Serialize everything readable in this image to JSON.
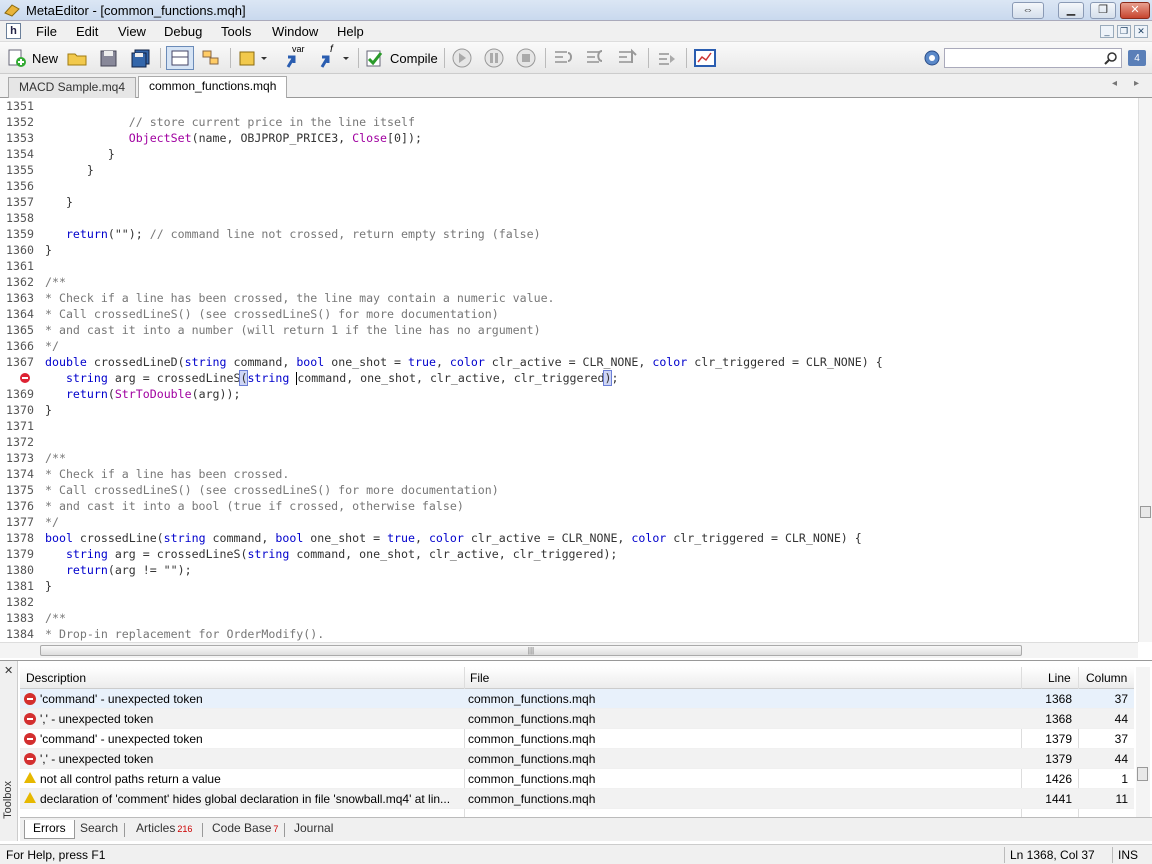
{
  "window": {
    "title": "MetaEditor - [common_functions.mqh]"
  },
  "menu": [
    "File",
    "Edit",
    "View",
    "Debug",
    "Tools",
    "Window",
    "Help"
  ],
  "toolbar": {
    "new_label": "New",
    "compile_label": "Compile",
    "var_label": "var",
    "f_label": "f",
    "search_placeholder": "",
    "badge": "4"
  },
  "tabs": [
    {
      "label": "MACD Sample.mq4",
      "active": false
    },
    {
      "label": "common_functions.mqh",
      "active": true
    }
  ],
  "code_lines": [
    {
      "n": "1351",
      "segs": []
    },
    {
      "n": "1352",
      "segs": [
        [
          "cm",
          "            // store current price in the line itself"
        ]
      ]
    },
    {
      "n": "1353",
      "segs": [
        [
          "t",
          "            "
        ],
        [
          "fn",
          "ObjectSet"
        ],
        [
          "t",
          "(name, OBJPROP_PRICE3, "
        ],
        [
          "fn",
          "Close"
        ],
        [
          "t",
          "[0]);"
        ]
      ]
    },
    {
      "n": "1354",
      "segs": [
        [
          "t",
          "         }"
        ]
      ]
    },
    {
      "n": "1355",
      "segs": [
        [
          "t",
          "      }"
        ]
      ]
    },
    {
      "n": "1356",
      "segs": []
    },
    {
      "n": "1357",
      "segs": [
        [
          "t",
          "   }"
        ]
      ]
    },
    {
      "n": "1358",
      "segs": []
    },
    {
      "n": "1359",
      "segs": [
        [
          "t",
          "   "
        ],
        [
          "kw",
          "return"
        ],
        [
          "t",
          "(\"\"); "
        ],
        [
          "cm",
          "// command line not crossed, return empty string (false)"
        ]
      ]
    },
    {
      "n": "1360",
      "segs": [
        [
          "t",
          "}"
        ]
      ]
    },
    {
      "n": "1361",
      "segs": []
    },
    {
      "n": "1362",
      "segs": [
        [
          "cm",
          "/**"
        ]
      ]
    },
    {
      "n": "1363",
      "segs": [
        [
          "cm",
          "* Check if a line has been crossed, the line may contain a numeric value."
        ]
      ]
    },
    {
      "n": "1364",
      "segs": [
        [
          "cm",
          "* Call crossedLineS() (see crossedLineS() for more documentation)"
        ]
      ]
    },
    {
      "n": "1365",
      "segs": [
        [
          "cm",
          "* and cast it into a number (will return 1 if the line has no argument)"
        ]
      ]
    },
    {
      "n": "1366",
      "segs": [
        [
          "cm",
          "*/"
        ]
      ]
    },
    {
      "n": "1367",
      "segs": [
        [
          "kw",
          "double"
        ],
        [
          "t",
          " crossedLineD("
        ],
        [
          "kw",
          "string"
        ],
        [
          "t",
          " command, "
        ],
        [
          "kw",
          "bool"
        ],
        [
          "t",
          " one_shot = "
        ],
        [
          "kw",
          "true"
        ],
        [
          "t",
          ", "
        ],
        [
          "kw",
          "color"
        ],
        [
          "t",
          " clr_active = CLR_NONE, "
        ],
        [
          "kw",
          "color"
        ],
        [
          "t",
          " clr_triggered = CLR_NONE) {"
        ]
      ]
    },
    {
      "n": "",
      "err": true,
      "segs": [
        [
          "t",
          "   "
        ],
        [
          "kw",
          "string"
        ],
        [
          "t",
          " arg = crossedLineS"
        ],
        [
          "hl",
          "("
        ],
        [
          "kw",
          "string"
        ],
        [
          "t",
          " "
        ],
        [
          "caret",
          ""
        ],
        [
          "t",
          "command, one_shot, clr_active, clr_triggered"
        ],
        [
          "hl",
          ")"
        ],
        [
          "t",
          ";"
        ]
      ]
    },
    {
      "n": "1369",
      "segs": [
        [
          "t",
          "   "
        ],
        [
          "kw",
          "return"
        ],
        [
          "t",
          "("
        ],
        [
          "fn",
          "StrToDouble"
        ],
        [
          "t",
          "(arg));"
        ]
      ]
    },
    {
      "n": "1370",
      "segs": [
        [
          "t",
          "}"
        ]
      ]
    },
    {
      "n": "1371",
      "segs": []
    },
    {
      "n": "1372",
      "segs": []
    },
    {
      "n": "1373",
      "segs": [
        [
          "cm",
          "/**"
        ]
      ]
    },
    {
      "n": "1374",
      "segs": [
        [
          "cm",
          "* Check if a line has been crossed."
        ]
      ]
    },
    {
      "n": "1375",
      "segs": [
        [
          "cm",
          "* Call crossedLineS() (see crossedLineS() for more documentation)"
        ]
      ]
    },
    {
      "n": "1376",
      "segs": [
        [
          "cm",
          "* and cast it into a bool (true if crossed, otherwise false)"
        ]
      ]
    },
    {
      "n": "1377",
      "segs": [
        [
          "cm",
          "*/"
        ]
      ]
    },
    {
      "n": "1378",
      "segs": [
        [
          "kw",
          "bool"
        ],
        [
          "t",
          " crossedLine("
        ],
        [
          "kw",
          "string"
        ],
        [
          "t",
          " command, "
        ],
        [
          "kw",
          "bool"
        ],
        [
          "t",
          " one_shot = "
        ],
        [
          "kw",
          "true"
        ],
        [
          "t",
          ", "
        ],
        [
          "kw",
          "color"
        ],
        [
          "t",
          " clr_active = CLR_NONE, "
        ],
        [
          "kw",
          "color"
        ],
        [
          "t",
          " clr_triggered = CLR_NONE) {"
        ]
      ]
    },
    {
      "n": "1379",
      "segs": [
        [
          "t",
          "   "
        ],
        [
          "kw",
          "string"
        ],
        [
          "t",
          " arg = crossedLineS("
        ],
        [
          "kw",
          "string"
        ],
        [
          "t",
          " command, one_shot, clr_active, clr_triggered);"
        ]
      ]
    },
    {
      "n": "1380",
      "segs": [
        [
          "t",
          "   "
        ],
        [
          "kw",
          "return"
        ],
        [
          "t",
          "(arg != \"\");"
        ]
      ]
    },
    {
      "n": "1381",
      "segs": [
        [
          "t",
          "}"
        ]
      ]
    },
    {
      "n": "1382",
      "segs": []
    },
    {
      "n": "1383",
      "segs": [
        [
          "cm",
          "/**"
        ]
      ]
    },
    {
      "n": "1384",
      "segs": [
        [
          "cm",
          "* Drop-in replacement for OrderModify()."
        ]
      ]
    }
  ],
  "errors": {
    "headers": {
      "description": "Description",
      "file": "File",
      "line": "Line",
      "column": "Column"
    },
    "rows": [
      {
        "kind": "error",
        "description": "'command' - unexpected token",
        "file": "common_functions.mqh",
        "line": "1368",
        "column": "37"
      },
      {
        "kind": "error",
        "description": "',' - unexpected token",
        "file": "common_functions.mqh",
        "line": "1368",
        "column": "44"
      },
      {
        "kind": "error",
        "description": "'command' - unexpected token",
        "file": "common_functions.mqh",
        "line": "1379",
        "column": "37"
      },
      {
        "kind": "error",
        "description": "',' - unexpected token",
        "file": "common_functions.mqh",
        "line": "1379",
        "column": "44"
      },
      {
        "kind": "warning",
        "description": "not all control paths return a value",
        "file": "common_functions.mqh",
        "line": "1426",
        "column": "1"
      },
      {
        "kind": "warning",
        "description": "declaration of 'comment' hides global declaration in file 'snowball.mq4' at lin...",
        "file": "common_functions.mqh",
        "line": "1441",
        "column": "11"
      }
    ]
  },
  "toolbox": {
    "label": "Toolbox",
    "tabs": [
      {
        "label": "Errors",
        "count": ""
      },
      {
        "label": "Search",
        "count": ""
      },
      {
        "label": "Articles",
        "count": "216"
      },
      {
        "label": "Code Base",
        "count": "7"
      },
      {
        "label": "Journal",
        "count": ""
      }
    ]
  },
  "status": {
    "help": "For Help, press F1",
    "position": "Ln 1368, Col 37",
    "mode": "INS"
  }
}
